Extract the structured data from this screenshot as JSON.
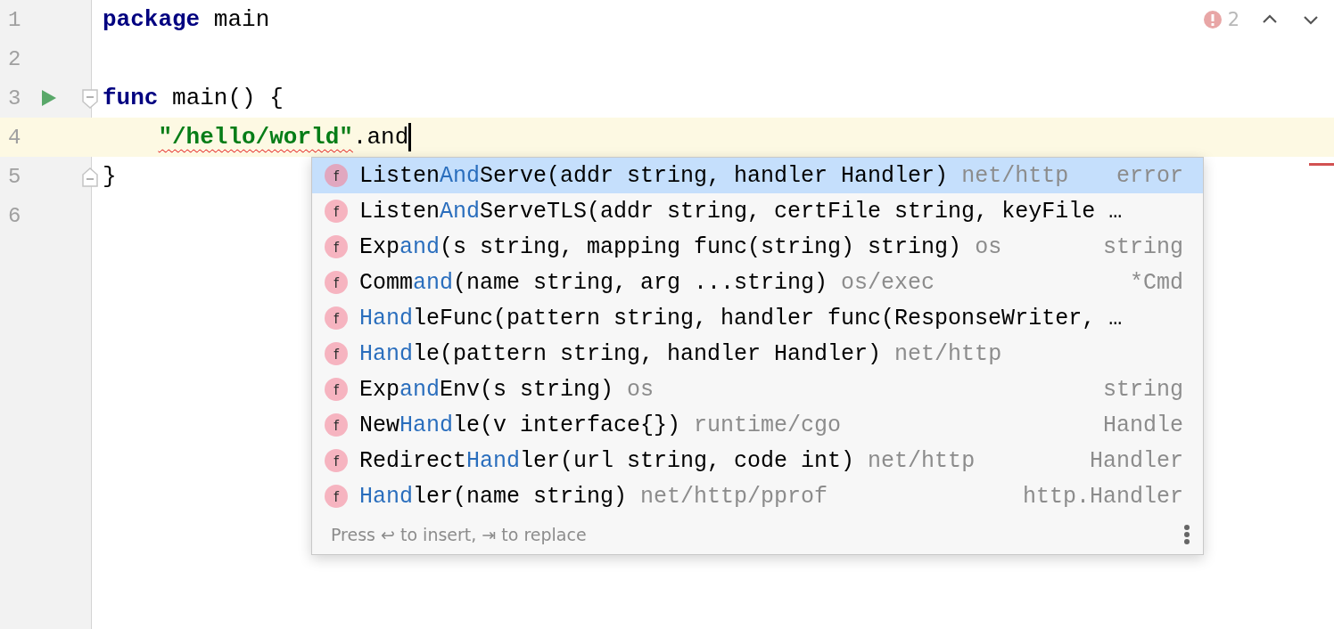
{
  "editor": {
    "lines": [
      {
        "number": "1",
        "current": false,
        "indented": false,
        "run": false,
        "fold_start": false,
        "fold_end": false,
        "caret": false,
        "tokens": [
          {
            "kind": "keyword",
            "text": "package"
          },
          {
            "kind": "plain",
            "text": " main"
          }
        ]
      },
      {
        "number": "2",
        "current": false,
        "run": false,
        "fold_start": false,
        "fold_end": false,
        "caret": false
      },
      {
        "number": "3",
        "current": false,
        "indented": false,
        "run": true,
        "fold_start": true,
        "fold_end": false,
        "caret": false,
        "tokens": [
          {
            "kind": "keyword",
            "text": "func"
          },
          {
            "kind": "plain",
            "text": " main() {"
          }
        ]
      },
      {
        "number": "4",
        "current": true,
        "indented": true,
        "run": false,
        "fold_start": false,
        "fold_end": false,
        "caret": true,
        "tokens": [
          {
            "kind": "string",
            "text": "\"/hello/world\"",
            "error": true
          },
          {
            "kind": "plain",
            "text": ".and"
          }
        ]
      },
      {
        "number": "5",
        "current": false,
        "indented": false,
        "run": false,
        "fold_start": false,
        "fold_end": true,
        "caret": false,
        "tokens": [
          {
            "kind": "plain",
            "text": "}"
          }
        ]
      },
      {
        "number": "6",
        "current": false,
        "run": false,
        "fold_start": false,
        "fold_end": false,
        "caret": false
      }
    ]
  },
  "inspections": {
    "error_count": "2"
  },
  "completion": {
    "items": [
      {
        "icon_letter": "f",
        "selected": true,
        "before": "Listen",
        "match": "And",
        "after": "Serve(addr string, handler Handler)",
        "package": "net/http",
        "type": "error"
      },
      {
        "icon_letter": "f",
        "selected": false,
        "before": "Listen",
        "match": "And",
        "after": "ServeTLS(addr string, certFile string, keyFile …"
      },
      {
        "icon_letter": "f",
        "selected": false,
        "before": "Exp",
        "match": "and",
        "after": "(s string, mapping func(string) string)",
        "package": "os",
        "type": "string"
      },
      {
        "icon_letter": "f",
        "selected": false,
        "before": "Comm",
        "match": "and",
        "after": "(name string, arg ...string)",
        "package": "os/exec",
        "type": "*Cmd"
      },
      {
        "icon_letter": "f",
        "selected": false,
        "match": "Hand",
        "after": "leFunc(pattern string, handler func(ResponseWriter, …"
      },
      {
        "icon_letter": "f",
        "selected": false,
        "match": "Hand",
        "after": "le(pattern string, handler Handler)",
        "package": "net/http"
      },
      {
        "icon_letter": "f",
        "selected": false,
        "before": "Exp",
        "match": "and",
        "after": "Env(s string)",
        "package": "os",
        "type": "string"
      },
      {
        "icon_letter": "f",
        "selected": false,
        "before": "New",
        "match": "Hand",
        "after": "le(v interface{})",
        "package": "runtime/cgo",
        "type": "Handle"
      },
      {
        "icon_letter": "f",
        "selected": false,
        "before": "Redirect",
        "match": "Hand",
        "after": "ler(url string, code int)",
        "package": "net/http",
        "type": "Handler"
      },
      {
        "icon_letter": "f",
        "selected": false,
        "match": "Hand",
        "after": "ler(name string)",
        "package": "net/http/pprof",
        "type": "http.Handler"
      }
    ],
    "hint": "Press ↩ to insert, ⇥ to replace"
  }
}
